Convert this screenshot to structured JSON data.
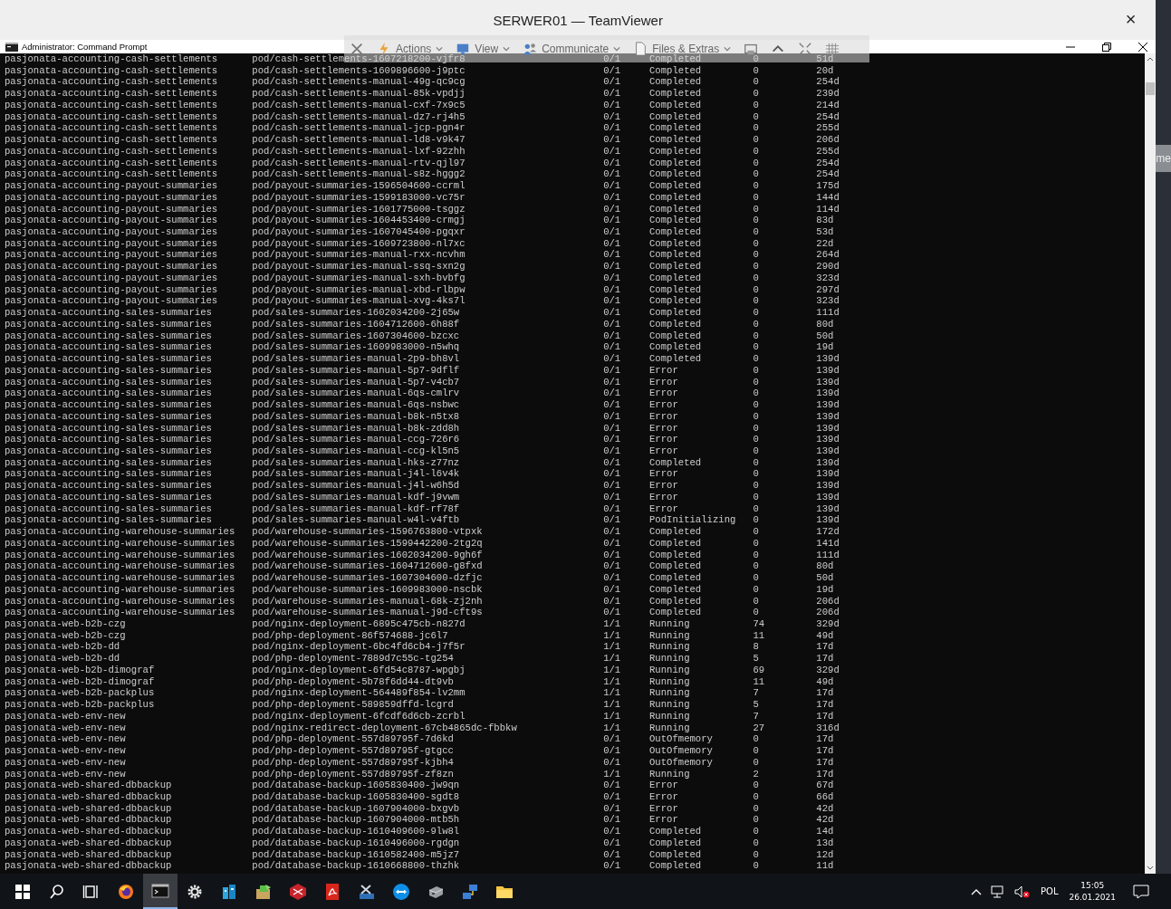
{
  "teamviewer": {
    "title": "SERWER01 — TeamViewer",
    "close": "×"
  },
  "console": {
    "title": "Administrator: Command Prompt"
  },
  "toolbar": {
    "items": [
      {
        "kind": "close"
      },
      {
        "kind": "actions",
        "label": "Actions"
      },
      {
        "kind": "view",
        "label": "View"
      },
      {
        "kind": "communicate",
        "label": "Communicate"
      },
      {
        "kind": "files",
        "label": "Files & Extras"
      },
      {
        "kind": "window"
      },
      {
        "kind": "collapse"
      },
      {
        "kind": "fullscreen"
      },
      {
        "kind": "grid"
      }
    ]
  },
  "rows": [
    [
      "pasjonata-accounting-cash-settlements",
      "pod/cash-settlements-1607218200-vjfr8",
      "0/1",
      "Completed",
      "0",
      "51d"
    ],
    [
      "pasjonata-accounting-cash-settlements",
      "pod/cash-settlements-1609896600-j9ptc",
      "0/1",
      "Completed",
      "0",
      "20d"
    ],
    [
      "pasjonata-accounting-cash-settlements",
      "pod/cash-settlements-manual-49g-qc9cg",
      "0/1",
      "Completed",
      "0",
      "254d"
    ],
    [
      "pasjonata-accounting-cash-settlements",
      "pod/cash-settlements-manual-85k-vpdjj",
      "0/1",
      "Completed",
      "0",
      "239d"
    ],
    [
      "pasjonata-accounting-cash-settlements",
      "pod/cash-settlements-manual-cxf-7x9c5",
      "0/1",
      "Completed",
      "0",
      "214d"
    ],
    [
      "pasjonata-accounting-cash-settlements",
      "pod/cash-settlements-manual-dz7-rj4h5",
      "0/1",
      "Completed",
      "0",
      "254d"
    ],
    [
      "pasjonata-accounting-cash-settlements",
      "pod/cash-settlements-manual-jcp-pgn4r",
      "0/1",
      "Completed",
      "0",
      "255d"
    ],
    [
      "pasjonata-accounting-cash-settlements",
      "pod/cash-settlements-manual-ld8-v9k47",
      "0/1",
      "Completed",
      "0",
      "206d"
    ],
    [
      "pasjonata-accounting-cash-settlements",
      "pod/cash-settlements-manual-lxf-92zhh",
      "0/1",
      "Completed",
      "0",
      "255d"
    ],
    [
      "pasjonata-accounting-cash-settlements",
      "pod/cash-settlements-manual-rtv-qjl97",
      "0/1",
      "Completed",
      "0",
      "254d"
    ],
    [
      "pasjonata-accounting-cash-settlements",
      "pod/cash-settlements-manual-s8z-hggg2",
      "0/1",
      "Completed",
      "0",
      "254d"
    ],
    [
      "pasjonata-accounting-payout-summaries",
      "pod/payout-summaries-1596504600-ccrml",
      "0/1",
      "Completed",
      "0",
      "175d"
    ],
    [
      "pasjonata-accounting-payout-summaries",
      "pod/payout-summaries-1599183000-vc75r",
      "0/1",
      "Completed",
      "0",
      "144d"
    ],
    [
      "pasjonata-accounting-payout-summaries",
      "pod/payout-summaries-1601775000-tsggz",
      "0/1",
      "Completed",
      "0",
      "114d"
    ],
    [
      "pasjonata-accounting-payout-summaries",
      "pod/payout-summaries-1604453400-crmgj",
      "0/1",
      "Completed",
      "0",
      "83d"
    ],
    [
      "pasjonata-accounting-payout-summaries",
      "pod/payout-summaries-1607045400-pgqxr",
      "0/1",
      "Completed",
      "0",
      "53d"
    ],
    [
      "pasjonata-accounting-payout-summaries",
      "pod/payout-summaries-1609723800-nl7xc",
      "0/1",
      "Completed",
      "0",
      "22d"
    ],
    [
      "pasjonata-accounting-payout-summaries",
      "pod/payout-summaries-manual-rxx-ncvhm",
      "0/1",
      "Completed",
      "0",
      "264d"
    ],
    [
      "pasjonata-accounting-payout-summaries",
      "pod/payout-summaries-manual-ssq-sxn2g",
      "0/1",
      "Completed",
      "0",
      "290d"
    ],
    [
      "pasjonata-accounting-payout-summaries",
      "pod/payout-summaries-manual-sxh-bvbfg",
      "0/1",
      "Completed",
      "0",
      "323d"
    ],
    [
      "pasjonata-accounting-payout-summaries",
      "pod/payout-summaries-manual-xbd-rlbpw",
      "0/1",
      "Completed",
      "0",
      "297d"
    ],
    [
      "pasjonata-accounting-payout-summaries",
      "pod/payout-summaries-manual-xvg-4ks7l",
      "0/1",
      "Completed",
      "0",
      "323d"
    ],
    [
      "pasjonata-accounting-sales-summaries",
      "pod/sales-summaries-1602034200-2j65w",
      "0/1",
      "Completed",
      "0",
      "111d"
    ],
    [
      "pasjonata-accounting-sales-summaries",
      "pod/sales-summaries-1604712600-6h88f",
      "0/1",
      "Completed",
      "0",
      "80d"
    ],
    [
      "pasjonata-accounting-sales-summaries",
      "pod/sales-summaries-1607304600-bzcxc",
      "0/1",
      "Completed",
      "0",
      "50d"
    ],
    [
      "pasjonata-accounting-sales-summaries",
      "pod/sales-summaries-1609983000-n5whq",
      "0/1",
      "Completed",
      "0",
      "19d"
    ],
    [
      "pasjonata-accounting-sales-summaries",
      "pod/sales-summaries-manual-2p9-bh8vl",
      "0/1",
      "Completed",
      "0",
      "139d"
    ],
    [
      "pasjonata-accounting-sales-summaries",
      "pod/sales-summaries-manual-5p7-9dflf",
      "0/1",
      "Error",
      "0",
      "139d"
    ],
    [
      "pasjonata-accounting-sales-summaries",
      "pod/sales-summaries-manual-5p7-v4cb7",
      "0/1",
      "Error",
      "0",
      "139d"
    ],
    [
      "pasjonata-accounting-sales-summaries",
      "pod/sales-summaries-manual-6qs-cmlrv",
      "0/1",
      "Error",
      "0",
      "139d"
    ],
    [
      "pasjonata-accounting-sales-summaries",
      "pod/sales-summaries-manual-6qs-nsbwc",
      "0/1",
      "Error",
      "0",
      "139d"
    ],
    [
      "pasjonata-accounting-sales-summaries",
      "pod/sales-summaries-manual-b8k-n5tx8",
      "0/1",
      "Error",
      "0",
      "139d"
    ],
    [
      "pasjonata-accounting-sales-summaries",
      "pod/sales-summaries-manual-b8k-zdd8h",
      "0/1",
      "Error",
      "0",
      "139d"
    ],
    [
      "pasjonata-accounting-sales-summaries",
      "pod/sales-summaries-manual-ccg-726r6",
      "0/1",
      "Error",
      "0",
      "139d"
    ],
    [
      "pasjonata-accounting-sales-summaries",
      "pod/sales-summaries-manual-ccg-kl5n5",
      "0/1",
      "Error",
      "0",
      "139d"
    ],
    [
      "pasjonata-accounting-sales-summaries",
      "pod/sales-summaries-manual-hks-z77nz",
      "0/1",
      "Completed",
      "0",
      "139d"
    ],
    [
      "pasjonata-accounting-sales-summaries",
      "pod/sales-summaries-manual-j4l-l6v4k",
      "0/1",
      "Error",
      "0",
      "139d"
    ],
    [
      "pasjonata-accounting-sales-summaries",
      "pod/sales-summaries-manual-j4l-w6h5d",
      "0/1",
      "Error",
      "0",
      "139d"
    ],
    [
      "pasjonata-accounting-sales-summaries",
      "pod/sales-summaries-manual-kdf-j9vwm",
      "0/1",
      "Error",
      "0",
      "139d"
    ],
    [
      "pasjonata-accounting-sales-summaries",
      "pod/sales-summaries-manual-kdf-rf78f",
      "0/1",
      "Error",
      "0",
      "139d"
    ],
    [
      "pasjonata-accounting-sales-summaries",
      "pod/sales-summaries-manual-w4l-v4ftb",
      "0/1",
      "PodInitializing",
      "0",
      "139d"
    ],
    [
      "pasjonata-accounting-warehouse-summaries",
      "pod/warehouse-summaries-1596763800-vtpxk",
      "0/1",
      "Completed",
      "0",
      "172d"
    ],
    [
      "pasjonata-accounting-warehouse-summaries",
      "pod/warehouse-summaries-1599442200-2tg2q",
      "0/1",
      "Completed",
      "0",
      "141d"
    ],
    [
      "pasjonata-accounting-warehouse-summaries",
      "pod/warehouse-summaries-1602034200-9gh6f",
      "0/1",
      "Completed",
      "0",
      "111d"
    ],
    [
      "pasjonata-accounting-warehouse-summaries",
      "pod/warehouse-summaries-1604712600-g8fxd",
      "0/1",
      "Completed",
      "0",
      "80d"
    ],
    [
      "pasjonata-accounting-warehouse-summaries",
      "pod/warehouse-summaries-1607304600-dzfjc",
      "0/1",
      "Completed",
      "0",
      "50d"
    ],
    [
      "pasjonata-accounting-warehouse-summaries",
      "pod/warehouse-summaries-1609983000-nscbk",
      "0/1",
      "Completed",
      "0",
      "19d"
    ],
    [
      "pasjonata-accounting-warehouse-summaries",
      "pod/warehouse-summaries-manual-68k-zj2nh",
      "0/1",
      "Completed",
      "0",
      "206d"
    ],
    [
      "pasjonata-accounting-warehouse-summaries",
      "pod/warehouse-summaries-manual-j9d-cft9s",
      "0/1",
      "Completed",
      "0",
      "206d"
    ],
    [
      "pasjonata-web-b2b-czg",
      "pod/nginx-deployment-6895c475cb-n827d",
      "1/1",
      "Running",
      "74",
      "329d"
    ],
    [
      "pasjonata-web-b2b-czg",
      "pod/php-deployment-86f574688-jc6l7",
      "1/1",
      "Running",
      "11",
      "49d"
    ],
    [
      "pasjonata-web-b2b-dd",
      "pod/nginx-deployment-6bc4fd6cb4-j7f5r",
      "1/1",
      "Running",
      "8",
      "17d"
    ],
    [
      "pasjonata-web-b2b-dd",
      "pod/php-deployment-7889d7c55c-tg254",
      "1/1",
      "Running",
      "5",
      "17d"
    ],
    [
      "pasjonata-web-b2b-dimograf",
      "pod/nginx-deployment-6fd54c8787-wpgbj",
      "1/1",
      "Running",
      "69",
      "329d"
    ],
    [
      "pasjonata-web-b2b-dimograf",
      "pod/php-deployment-5b78f6dd44-dt9vb",
      "1/1",
      "Running",
      "11",
      "49d"
    ],
    [
      "pasjonata-web-b2b-packplus",
      "pod/nginx-deployment-564489f854-lv2mm",
      "1/1",
      "Running",
      "7",
      "17d"
    ],
    [
      "pasjonata-web-b2b-packplus",
      "pod/php-deployment-589859dffd-lcgrd",
      "1/1",
      "Running",
      "5",
      "17d"
    ],
    [
      "pasjonata-web-env-new",
      "pod/nginx-deployment-6fcdf6d6cb-zcrbl",
      "1/1",
      "Running",
      "7",
      "17d"
    ],
    [
      "pasjonata-web-env-new",
      "pod/nginx-redirect-deployment-67cb4865dc-fbbkw",
      "1/1",
      "Running",
      "27",
      "316d"
    ],
    [
      "pasjonata-web-env-new",
      "pod/php-deployment-557d89795f-7d6kd",
      "0/1",
      "OutOfmemory",
      "0",
      "17d"
    ],
    [
      "pasjonata-web-env-new",
      "pod/php-deployment-557d89795f-gtgcc",
      "0/1",
      "OutOfmemory",
      "0",
      "17d"
    ],
    [
      "pasjonata-web-env-new",
      "pod/php-deployment-557d89795f-kjbh4",
      "0/1",
      "OutOfmemory",
      "0",
      "17d"
    ],
    [
      "pasjonata-web-env-new",
      "pod/php-deployment-557d89795f-zf8zn",
      "1/1",
      "Running",
      "2",
      "17d"
    ],
    [
      "pasjonata-web-shared-dbbackup",
      "pod/database-backup-1605830400-jw9qn",
      "0/1",
      "Error",
      "0",
      "67d"
    ],
    [
      "pasjonata-web-shared-dbbackup",
      "pod/database-backup-1605830400-sgdt8",
      "0/1",
      "Error",
      "0",
      "66d"
    ],
    [
      "pasjonata-web-shared-dbbackup",
      "pod/database-backup-1607904000-bxgvb",
      "0/1",
      "Error",
      "0",
      "42d"
    ],
    [
      "pasjonata-web-shared-dbbackup",
      "pod/database-backup-1607904000-mtb5h",
      "0/1",
      "Error",
      "0",
      "42d"
    ],
    [
      "pasjonata-web-shared-dbbackup",
      "pod/database-backup-1610409600-9lw8l",
      "0/1",
      "Completed",
      "0",
      "14d"
    ],
    [
      "pasjonata-web-shared-dbbackup",
      "pod/database-backup-1610496000-rgdgn",
      "0/1",
      "Completed",
      "0",
      "13d"
    ],
    [
      "pasjonata-web-shared-dbbackup",
      "pod/database-backup-1610582400-m5jz7",
      "0/1",
      "Completed",
      "0",
      "12d"
    ],
    [
      "pasjonata-web-shared-dbbackup",
      "pod/database-backup-1610668800-thzhk",
      "0/1",
      "Completed",
      "0",
      "11d"
    ]
  ],
  "desktop": {
    "partial_text": "me"
  },
  "taskbar": {
    "apps": [
      {
        "kind": "start",
        "selected": false
      },
      {
        "kind": "search",
        "selected": false
      },
      {
        "kind": "taskview",
        "selected": false
      },
      {
        "kind": "browser",
        "selected": false
      },
      {
        "kind": "terminal",
        "selected": true
      },
      {
        "kind": "gear",
        "selected": false
      },
      {
        "kind": "building",
        "selected": false
      },
      {
        "kind": "box",
        "selected": false
      },
      {
        "kind": "redbox",
        "selected": false
      },
      {
        "kind": "pdf",
        "selected": false
      },
      {
        "kind": "tools",
        "selected": false
      },
      {
        "kind": "remote",
        "selected": false
      },
      {
        "kind": "server",
        "selected": false
      },
      {
        "kind": "network",
        "selected": false
      },
      {
        "kind": "folder",
        "selected": false
      }
    ],
    "tray": {
      "language": "POL",
      "time": "15:05",
      "date": "26.01.2021"
    }
  }
}
